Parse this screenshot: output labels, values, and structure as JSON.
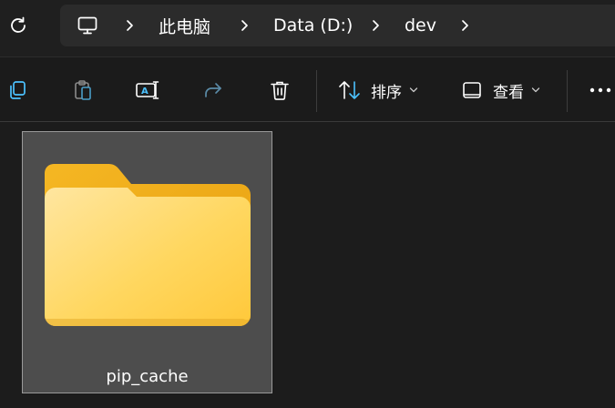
{
  "breadcrumb": {
    "items": [
      {
        "label": "此电脑"
      },
      {
        "label": "Data (D:)"
      },
      {
        "label": "dev"
      }
    ]
  },
  "toolbar": {
    "sort_label": "排序",
    "view_label": "查看",
    "more_icon": "more-icon",
    "icons": [
      "copy-icon",
      "paste-icon",
      "rename-icon",
      "share-icon",
      "delete-icon",
      "sort-icon",
      "view-icon"
    ]
  },
  "files": [
    {
      "name": "pip_cache",
      "type": "folder",
      "selected": true
    }
  ],
  "colors": {
    "background": "#1c1c1c",
    "accent": "#4cc2ff",
    "folder_back": "#f2b51f",
    "folder_front": "#ffd561",
    "selection": "#4d4d4d"
  }
}
